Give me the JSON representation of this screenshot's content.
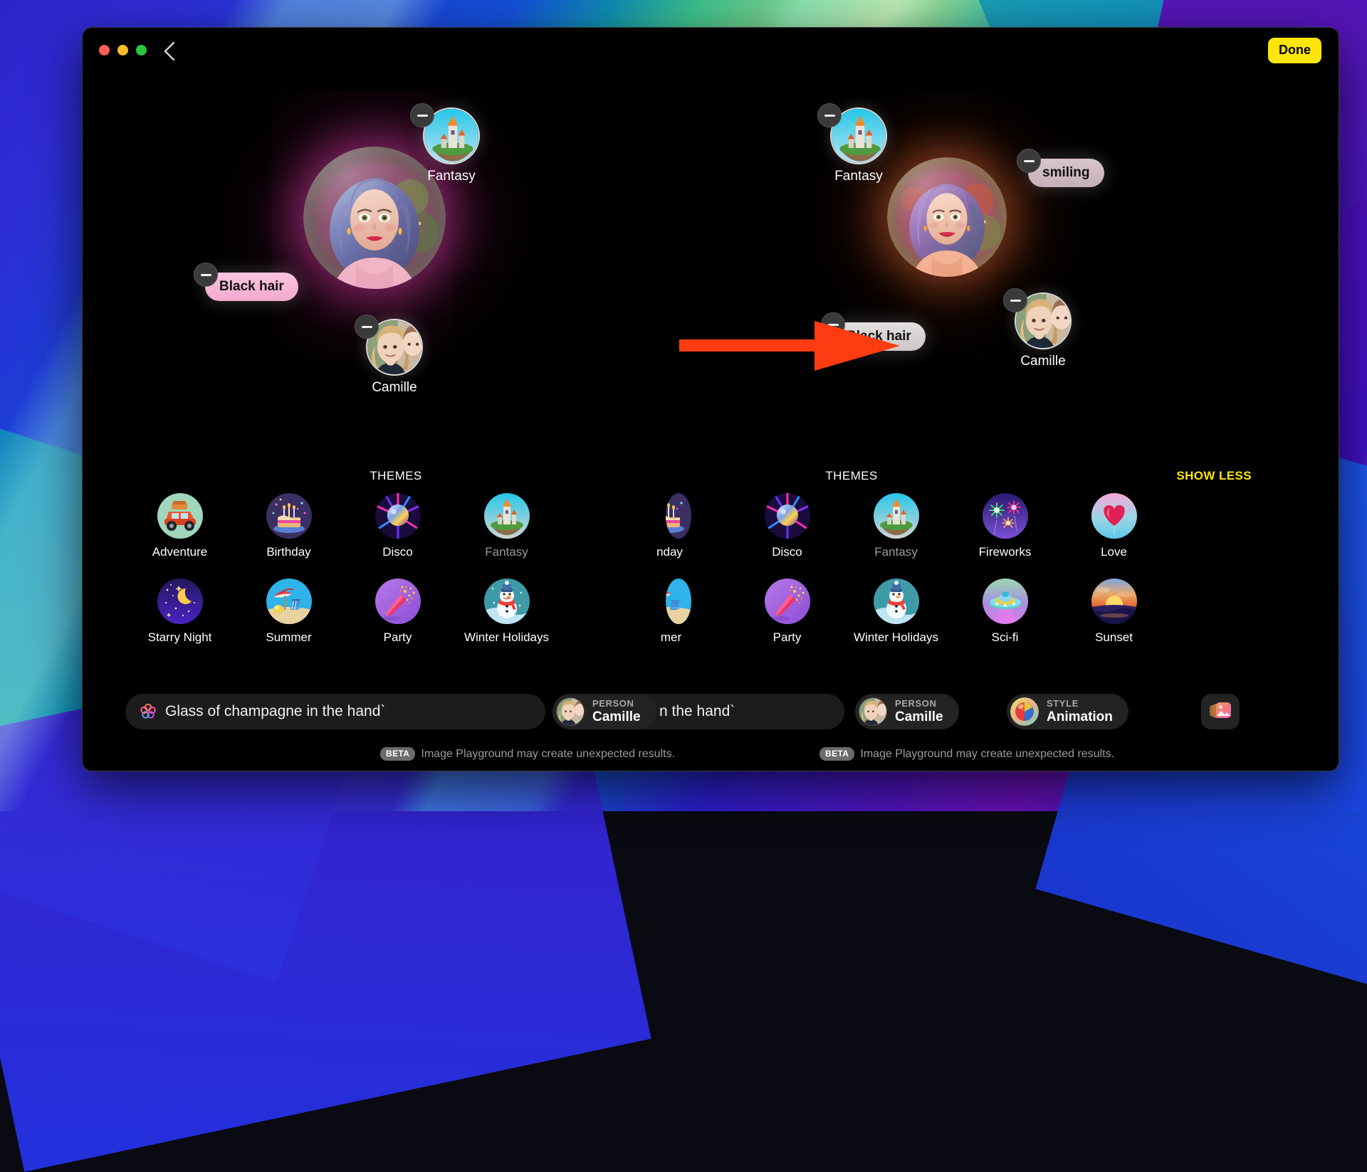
{
  "window": {
    "back_icon": "chevron-left-icon",
    "done_label": "Done",
    "accent_yellow": "#FFE60A"
  },
  "compositions": [
    {
      "id": "left",
      "person_name": "Camille",
      "tokens": [
        {
          "type": "theme",
          "label": "Fantasy",
          "icon": "castle-island-icon"
        },
        {
          "type": "attribute",
          "label": "Black hair",
          "style": "pink"
        },
        {
          "type": "person",
          "label": "Camille",
          "icon": "person-photo-icon"
        }
      ],
      "themes_header": "THEMES",
      "themes_row1": [
        {
          "label": "Adventure",
          "icon": "jeep-icon",
          "selected": false
        },
        {
          "label": "Birthday",
          "icon": "birthday-cake-icon",
          "selected": false
        },
        {
          "label": "Disco",
          "icon": "disco-ball-icon",
          "selected": false
        },
        {
          "label": "Fantasy",
          "icon": "castle-island-icon",
          "selected": true
        }
      ],
      "themes_row2": [
        {
          "label": "Starry Night",
          "icon": "moon-stars-icon",
          "selected": false
        },
        {
          "label": "Summer",
          "icon": "beach-icon",
          "selected": false
        },
        {
          "label": "Party",
          "icon": "party-cone-icon",
          "selected": false
        },
        {
          "label": "Winter Holidays",
          "icon": "snowman-icon",
          "selected": false
        }
      ],
      "prompt_text": "Glass of champagne in the hand`",
      "prompt_icon": "sparkle-flower-icon",
      "beta_tag": "BETA",
      "beta_text": "Image Playground may create unexpected results."
    },
    {
      "id": "right",
      "person_name": "Camille",
      "tokens": [
        {
          "type": "theme",
          "label": "Fantasy",
          "icon": "castle-island-icon"
        },
        {
          "type": "attribute",
          "label": "smiling",
          "style": "greypink"
        },
        {
          "type": "attribute",
          "label": "Black hair",
          "style": "grey"
        },
        {
          "type": "person",
          "label": "Camille",
          "icon": "person-photo-icon"
        }
      ],
      "themes_header": "THEMES",
      "show_less_label": "SHOW LESS",
      "themes_row1": [
        {
          "label": "nday",
          "icon": "birthday-cake-icon",
          "selected": false,
          "clipped": true
        },
        {
          "label": "Disco",
          "icon": "disco-ball-icon",
          "selected": false
        },
        {
          "label": "Fantasy",
          "icon": "castle-island-icon",
          "selected": true
        },
        {
          "label": "Fireworks",
          "icon": "fireworks-icon",
          "selected": false
        },
        {
          "label": "Love",
          "icon": "heart-balloon-icon",
          "selected": false
        }
      ],
      "themes_row2": [
        {
          "label": "mer",
          "icon": "beach-icon",
          "selected": false,
          "clipped": true
        },
        {
          "label": "Party",
          "icon": "party-cone-icon",
          "selected": false
        },
        {
          "label": "Winter Holidays",
          "icon": "snowman-icon",
          "selected": false
        },
        {
          "label": "Sci-fi",
          "icon": "ufo-icon",
          "selected": false
        },
        {
          "label": "Sunset",
          "icon": "sunset-icon",
          "selected": false
        }
      ],
      "prompt_text": "n the hand`",
      "person_chip": {
        "kicker": "PERSON",
        "value": "Camille",
        "icon": "person-photo-icon"
      },
      "style_chip": {
        "kicker": "STYLE",
        "value": "Animation",
        "icon": "color-ball-icon"
      },
      "image_button_icon": "photos-stack-icon",
      "beta_tag": "BETA",
      "beta_text": "Image Playground may create unexpected results."
    }
  ],
  "middle_person_chip": {
    "kicker": "PERSON",
    "value": "Camille",
    "icon": "person-photo-icon"
  },
  "annotation": {
    "arrow_color": "#FF3B11",
    "arrow_icon": "right-arrow-annotation"
  }
}
